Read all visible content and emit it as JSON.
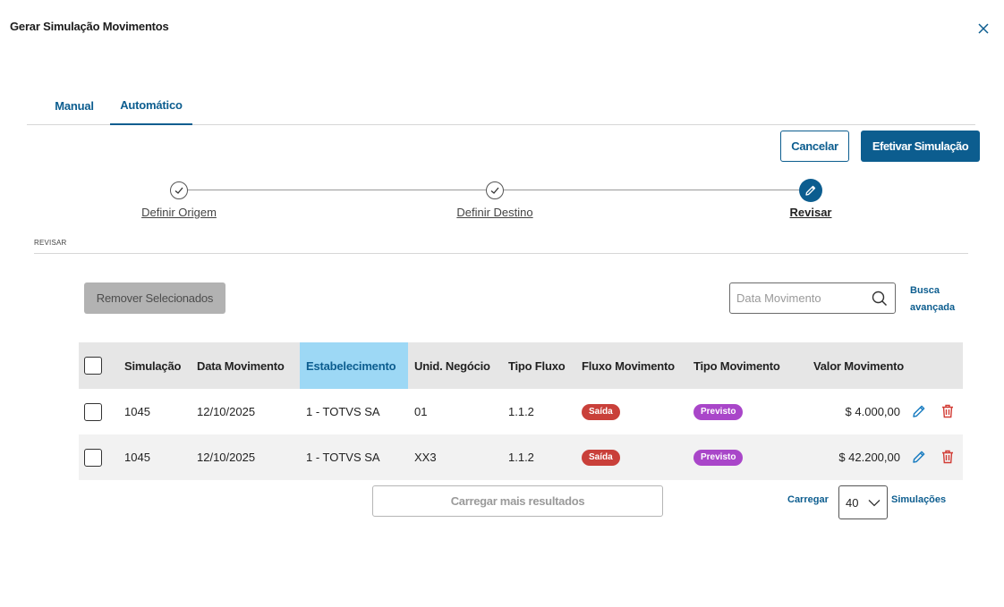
{
  "modal": {
    "title": "Gerar Simulação Movimentos"
  },
  "tabs": [
    {
      "label": "Manual"
    },
    {
      "label": "Automático"
    }
  ],
  "actions": {
    "cancel_label": "Cancelar",
    "confirm_label": "Efetivar Simulação"
  },
  "stepper": {
    "steps": [
      {
        "label": "Definir Origem",
        "state": "done",
        "icon": "check-icon"
      },
      {
        "label": "Definir Destino",
        "state": "done",
        "icon": "check-icon"
      },
      {
        "label": "Revisar",
        "state": "active",
        "icon": "pencil-icon"
      }
    ]
  },
  "section": {
    "label": "REVISAR"
  },
  "toolbar": {
    "remove_label": "Remover Selecionados",
    "search_placeholder": "Data Movimento",
    "advanced_search_line1": "Busca",
    "advanced_search_line2": "avançada"
  },
  "table": {
    "headers": [
      "Simulação",
      "Data Movimento",
      "Estabelecimento",
      "Unid. Negócio",
      "Tipo Fluxo",
      "Fluxo Movimento",
      "Tipo Movimento",
      "Valor Movimento"
    ],
    "sorted_column": "Estabelecimento",
    "rows": [
      {
        "simulacao": "1045",
        "data": "12/10/2025",
        "estabelecimento": "1 - TOTVS SA",
        "unidade": "01",
        "tipo_fluxo": "1.1.2",
        "fluxo": "Saída",
        "tipo_mov": "Previsto",
        "valor": "$ 4.000,00"
      },
      {
        "simulacao": "1045",
        "data": "12/10/2025",
        "estabelecimento": "1 - TOTVS SA",
        "unidade": "XX3",
        "tipo_fluxo": "1.1.2",
        "fluxo": "Saída",
        "tipo_mov": "Previsto",
        "valor": "$ 42.200,00"
      }
    ]
  },
  "pagination": {
    "load_more_label": "Carregar mais resultados",
    "load_label": "Carregar",
    "page_size": "40",
    "suffix_label": "Simulações"
  },
  "colors": {
    "primary": "#0c5d8f",
    "tag_saida": "#c9403a",
    "tag_previsto": "#a946c9",
    "sorted_header": "#9dd8f5"
  }
}
